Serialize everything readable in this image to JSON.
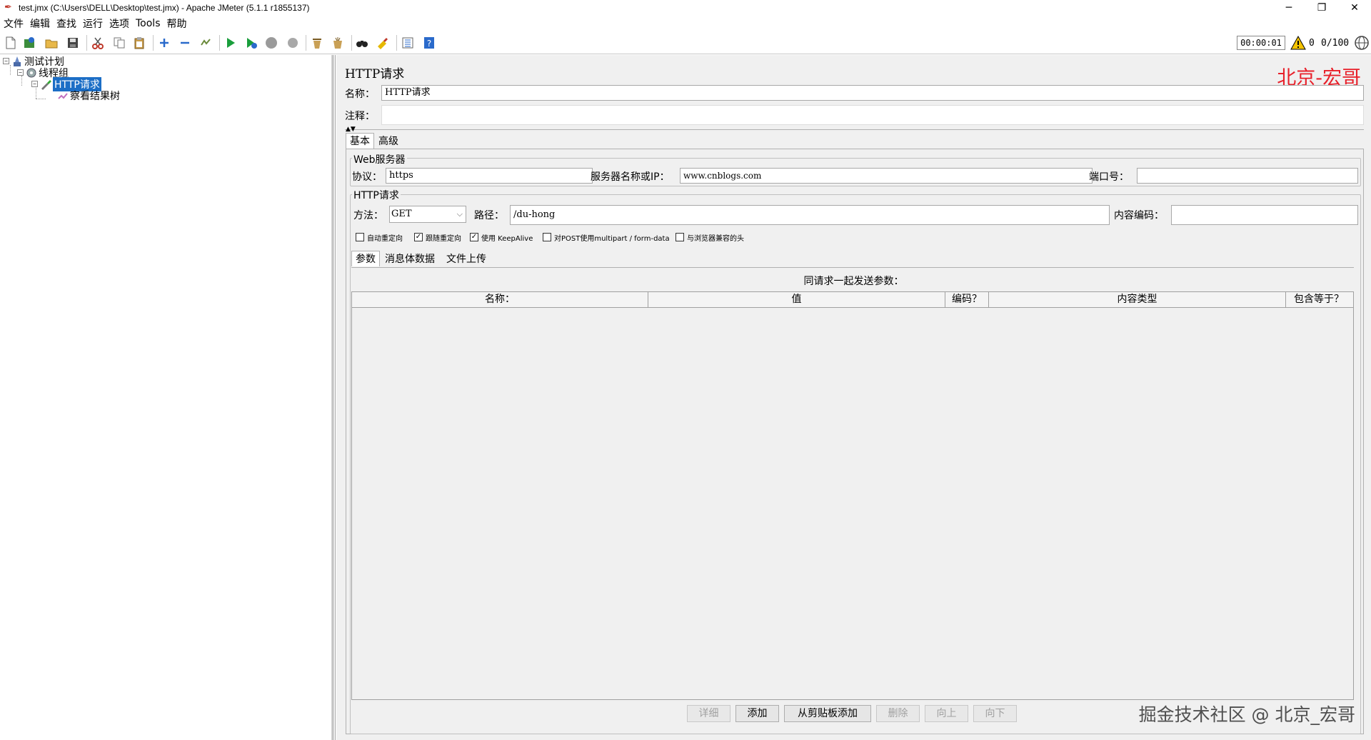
{
  "window": {
    "title": "test.jmx (C:\\Users\\DELL\\Desktop\\test.jmx) - Apache JMeter (5.1.1 r1855137)",
    "min": "─",
    "max": "❐",
    "close": "✕"
  },
  "menu": [
    "文件",
    "编辑",
    "查找",
    "运行",
    "选项",
    "Tools",
    "帮助"
  ],
  "status": {
    "timer": "00:00:01",
    "warnings": "0",
    "threads": "0/100"
  },
  "tree": {
    "plan": "测试计划",
    "thread_group": "线程组",
    "http_request": "HTTP请求",
    "result_tree": "察看结果树"
  },
  "panel": {
    "title": "HTTP请求",
    "watermark_top": "北京-宏哥",
    "name_label": "名称：",
    "name_value": "HTTP请求",
    "comment_label": "注释：",
    "comment_value": ""
  },
  "tabs": {
    "basic": "基本",
    "advanced": "高级"
  },
  "web_server": {
    "legend": "Web服务器",
    "protocol_label": "协议：",
    "protocol_value": "https",
    "server_label": "服务器名称或IP：",
    "server_value": "www.cnblogs.com",
    "port_label": "端口号：",
    "port_value": ""
  },
  "http_request": {
    "legend": "HTTP请求",
    "method_label": "方法：",
    "method_value": "GET",
    "path_label": "路径：",
    "path_value": "/du-hong",
    "encoding_label": "内容编码：",
    "encoding_value": ""
  },
  "checkboxes": [
    {
      "label": "自动重定向",
      "checked": false
    },
    {
      "label": "跟随重定向",
      "checked": true
    },
    {
      "label": "使用 KeepAlive",
      "checked": true
    },
    {
      "label": "对POST使用multipart / form-data",
      "checked": false
    },
    {
      "label": "与浏览器兼容的头",
      "checked": false
    }
  ],
  "param_tabs": {
    "params": "参数",
    "body": "消息体数据",
    "files": "文件上传"
  },
  "params_table": {
    "caption": "同请求一起发送参数：",
    "columns": [
      "名称：",
      "值",
      "编码？",
      "内容类型",
      "包含等于？"
    ]
  },
  "buttons": {
    "detail": "详细",
    "add": "添加",
    "add_clipboard": "从剪贴板添加",
    "delete": "删除",
    "up": "向上",
    "down": "向下"
  },
  "watermark_bottom": "掘金技术社区 @ 北京_宏哥",
  "colors": {
    "selection": "#1c6ec6",
    "watermark_red": "#e8202a",
    "play_green": "#1a9e3c"
  }
}
